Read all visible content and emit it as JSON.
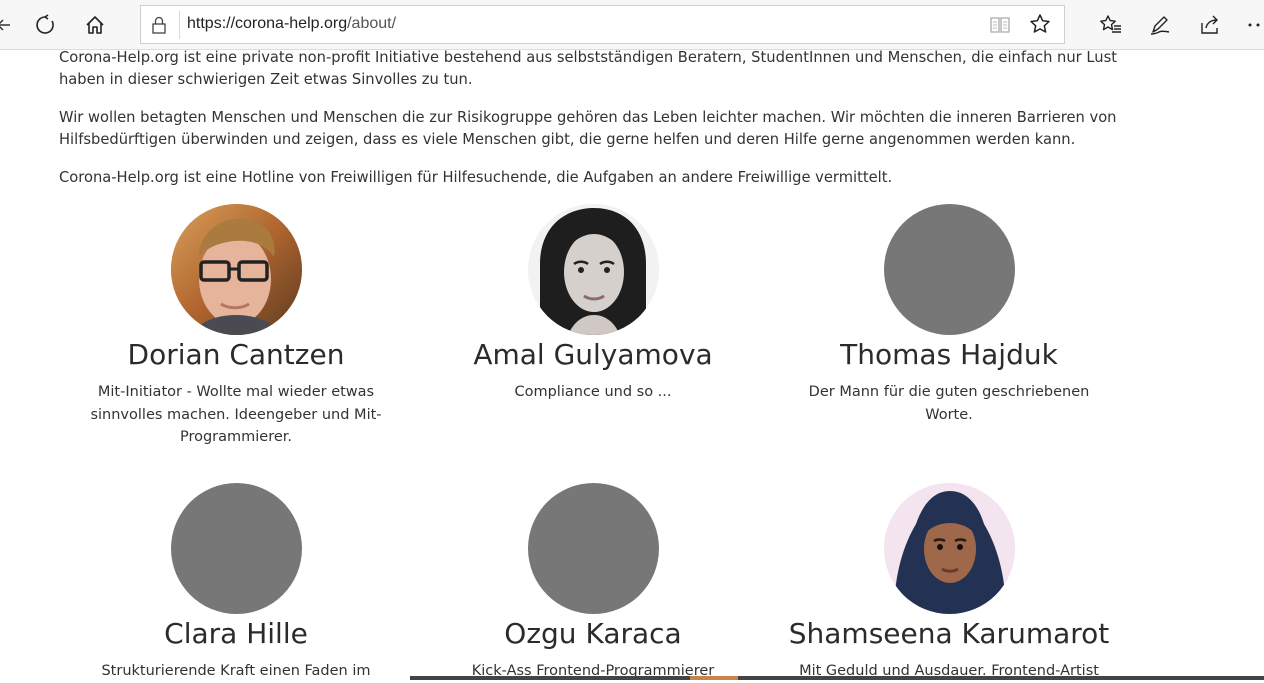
{
  "browser": {
    "url_host": "https://corona-help.org",
    "url_path": "/about/"
  },
  "intro": {
    "paragraphs": [
      "Corona-Help.org ist eine private non-profit Initiative bestehend aus selbstständigen Beratern, StudentInnen und Menschen, die einfach nur Lust haben in dieser schwierigen Zeit etwas Sinvolles zu tun.",
      "Wir wollen betagten Menschen und Menschen die zur Risikogruppe gehören das Leben leichter machen. Wir möchten die inneren Barrieren von Hilfsbedürftigen überwinden und zeigen, dass es viele Menschen gibt, die gerne helfen und deren Hilfe gerne angenommen werden kann.",
      "Corona-Help.org ist eine Hotline von Freiwilligen für Hilfesuchende, die Aufgaben an andere Freiwillige vermittelt."
    ]
  },
  "team": [
    {
      "name": "Dorian Cantzen",
      "role": "Mit-Initiator - Wollte mal wieder etwas sinnvolles machen. Ideengeber und Mit-Programmierer.",
      "photo": "photo"
    },
    {
      "name": "Amal Gulyamova",
      "role": "Compliance und so ...",
      "photo": "photo"
    },
    {
      "name": "Thomas Hajduk",
      "role": "Der Mann für die guten geschriebenen Worte.",
      "photo": "placeholder"
    },
    {
      "name": "Clara Hille",
      "role": "Strukturierende Kraft einen Faden im",
      "photo": "placeholder"
    },
    {
      "name": "Ozgu Karaca",
      "role": "Kick-Ass Frontend-Programmierer",
      "photo": "placeholder"
    },
    {
      "name": "Shamseena Karumarot",
      "role": "Mit Geduld und Ausdauer. Frontend-Artist",
      "photo": "photo"
    }
  ],
  "icons": {
    "back": "arrow-left-icon",
    "refresh": "refresh-icon",
    "home": "home-icon",
    "lock": "lock-icon",
    "reading_view": "reading-view-icon",
    "favorite": "star-icon",
    "favorites_list": "favorites-list-icon",
    "pen": "pen-icon",
    "share": "share-icon",
    "more": "more-icon"
  },
  "colors": {
    "toolbar_bg": "#f7f7f7",
    "avatar_placeholder": "#777777",
    "text": "#333333"
  }
}
